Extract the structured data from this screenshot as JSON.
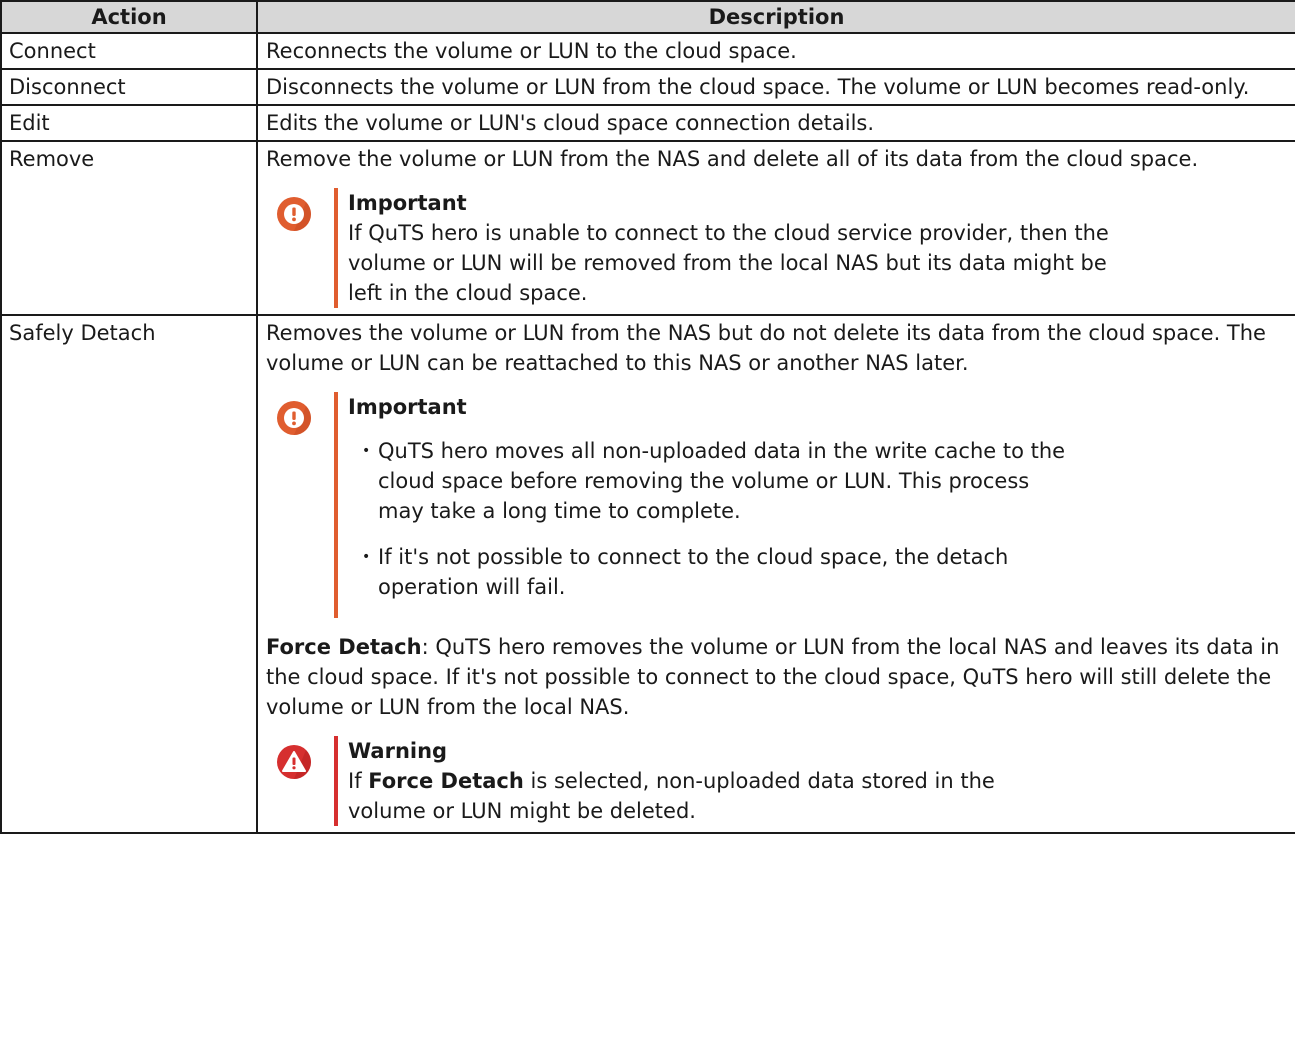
{
  "table": {
    "headers": {
      "action": "Action",
      "description": "Description"
    },
    "rows": [
      {
        "action": "Connect",
        "description": "Reconnects the volume or LUN to the cloud space."
      },
      {
        "action": "Disconnect",
        "description": "Disconnects the volume or LUN from the cloud space. The volume or LUN becomes read-only."
      },
      {
        "action": "Edit",
        "description": "Edits the volume or LUN's cloud space connection details."
      },
      {
        "action": "Remove",
        "description": "Remove the volume or LUN from the NAS and delete all of its data from the cloud space.",
        "note": {
          "title": "Important",
          "text": "If QuTS hero is unable to connect to the cloud service provider, then the volume or LUN will be removed from the local NAS but its data might be left in the cloud space."
        }
      },
      {
        "action": "Safely Detach",
        "description": "Removes the volume or LUN from the NAS but do not delete its data from the cloud space. The volume or LUN can be reattached to this NAS or another NAS later.",
        "note": {
          "title": "Important",
          "bullets": [
            "QuTS hero moves all non-uploaded data in the write cache to the cloud space before removing the volume or LUN. This process may take a long time to complete.",
            "If it's not possible to connect to the cloud space, the detach operation will fail."
          ]
        },
        "force_detach": {
          "term": "Force Detach",
          "text": ": QuTS hero removes the volume or LUN from the local NAS and leaves its data in the cloud space. If it's not possible to connect to the cloud space, QuTS hero will still delete the volume or LUN from the local NAS."
        },
        "warning": {
          "title": "Warning",
          "text_before": "If ",
          "term": "Force Detach",
          "text_after": " is selected, non-uploaded data stored in the volume or LUN might be deleted."
        }
      }
    ]
  },
  "colors": {
    "important": "#e05d2f",
    "warning": "#d62f2f",
    "header_bg": "#d7d7d7"
  },
  "icons": {
    "important": "exclamation-circle-icon",
    "warning": "warning-triangle-icon"
  }
}
